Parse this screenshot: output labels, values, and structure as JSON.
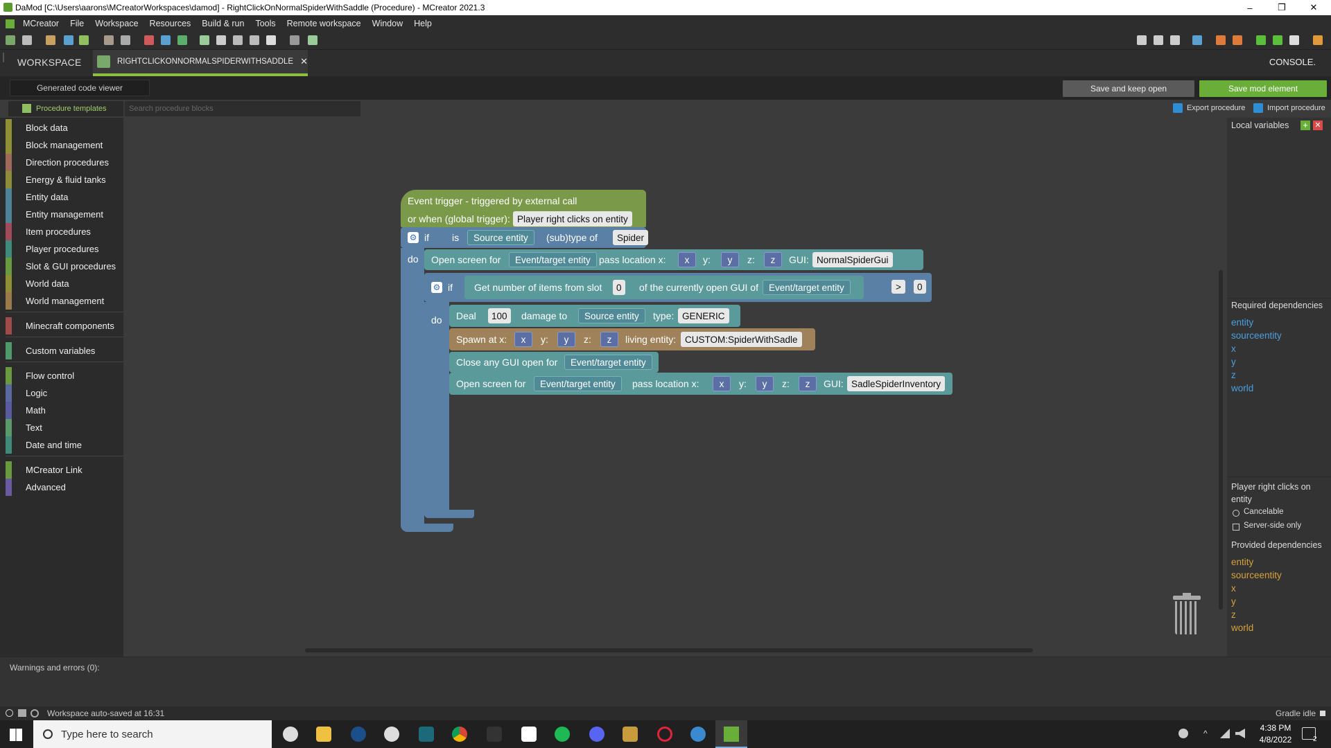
{
  "window": {
    "title": "DaMod [C:\\Users\\aarons\\MCreatorWorkspaces\\damod] - RightClickOnNormalSpiderWithSaddle (Procedure) - MCreator 2021.3",
    "minimize": "–",
    "maximize": "❐",
    "close": "✕"
  },
  "menu": [
    "MCreator",
    "File",
    "Workspace",
    "Resources",
    "Build & run",
    "Tools",
    "Remote workspace",
    "Window",
    "Help"
  ],
  "tabs": {
    "workspace": "WORKSPACE",
    "active": "RIGHTCLICKONNORMALSPIDERWITHSADDLE",
    "close": "✕",
    "console": "CONSOLE."
  },
  "subbar": {
    "generated_code": "Generated code viewer",
    "save_keep": "Save and keep open",
    "save_mod": "Save mod element"
  },
  "ribbon": {
    "templates": "Procedure templates",
    "search_placeholder": "Search procedure blocks",
    "export": "Export procedure",
    "import": "Import procedure"
  },
  "palette": [
    {
      "label": "Block data",
      "color": "#8f8f35"
    },
    {
      "label": "Block management",
      "color": "#8f8f35"
    },
    {
      "label": "Direction procedures",
      "color": "#a06a5b"
    },
    {
      "label": "Energy & fluid tanks",
      "color": "#8c8c3a"
    },
    {
      "label": "Entity data",
      "color": "#4f8296"
    },
    {
      "label": "Entity management",
      "color": "#4f8296"
    },
    {
      "label": "Item procedures",
      "color": "#a04a5a"
    },
    {
      "label": "Player procedures",
      "color": "#3f8a7a"
    },
    {
      "label": "Slot & GUI procedures",
      "color": "#6a9a3f"
    },
    {
      "label": "World data",
      "color": "#8f8f35"
    },
    {
      "label": "World management",
      "color": "#9a7a4a"
    },
    {
      "label": "Minecraft components",
      "color": "#a04a4a"
    },
    {
      "label": "Custom variables",
      "color": "#4f9a6a"
    },
    {
      "label": "Flow control",
      "color": "#6a9a3f"
    },
    {
      "label": "Logic",
      "color": "#5a6aa0"
    },
    {
      "label": "Math",
      "color": "#5a5aa0"
    },
    {
      "label": "Text",
      "color": "#5a9a6a"
    },
    {
      "label": "Date and time",
      "color": "#3f8a7a"
    },
    {
      "label": "MCreator Link",
      "color": "#6a9a3f"
    },
    {
      "label": "Advanced",
      "color": "#6a5aa0"
    }
  ],
  "blocks": {
    "event": {
      "line1": "Event trigger - triggered by external call",
      "line2": "or when (global trigger):",
      "trigger": "Player right clicks on entity"
    },
    "if1": {
      "if": "if",
      "is": "is",
      "entity": "Source entity",
      "subtype": "(sub)type of",
      "type": "Spider",
      "do": "do"
    },
    "open1": {
      "label": "Open screen for",
      "entity": "Event/target entity",
      "pass": "pass location x:",
      "x": "x",
      "ylabel": "y:",
      "y": "y",
      "zlabel": "z:",
      "z": "z",
      "gui_label": "GUI:",
      "gui": "NormalSpiderGui"
    },
    "if2": {
      "if": "if",
      "get": "Get number of items from slot",
      "slot": "0",
      "of": "of the currently open GUI of",
      "entity": "Event/target entity",
      "op": ">",
      "value": "0",
      "do": "do"
    },
    "deal": {
      "label": "Deal",
      "amount": "100",
      "to": "damage to",
      "entity": "Source entity",
      "type_label": "type:",
      "type": "GENERIC"
    },
    "spawn": {
      "label": "Spawn at x:",
      "x": "x",
      "ylabel": "y:",
      "y": "y",
      "zlabel": "z:",
      "z": "z",
      "living": "living entity:",
      "entity": "CUSTOM:SpiderWithSadle"
    },
    "close": {
      "label": "Close any GUI open for",
      "entity": "Event/target entity"
    },
    "open2": {
      "label": "Open screen for",
      "entity": "Event/target entity",
      "pass": "pass location x:",
      "x": "x",
      "ylabel": "y:",
      "y": "y",
      "zlabel": "z:",
      "z": "z",
      "gui_label": "GUI:",
      "gui": "SadleSpiderInventory"
    }
  },
  "right_panel": {
    "local_vars": "Local variables",
    "required_title": "Required dependencies",
    "required": [
      "entity",
      "sourceentity",
      "x",
      "y",
      "z",
      "world"
    ],
    "trigger_title": "Player right clicks on entity",
    "cancelable": "Cancelable",
    "server_side": "Server-side only",
    "provided_title": "Provided dependencies",
    "provided": [
      "entity",
      "sourceentity",
      "x",
      "y",
      "z",
      "world"
    ]
  },
  "bottom": {
    "warnings": "Warnings and errors (0):"
  },
  "status": {
    "autosave": "Workspace auto-saved at 16:31",
    "gradle": "Gradle idle"
  },
  "taskbar": {
    "search_placeholder": "Type here to search",
    "time": "4:38 PM",
    "date": "4/8/2022",
    "notifications": "2"
  }
}
